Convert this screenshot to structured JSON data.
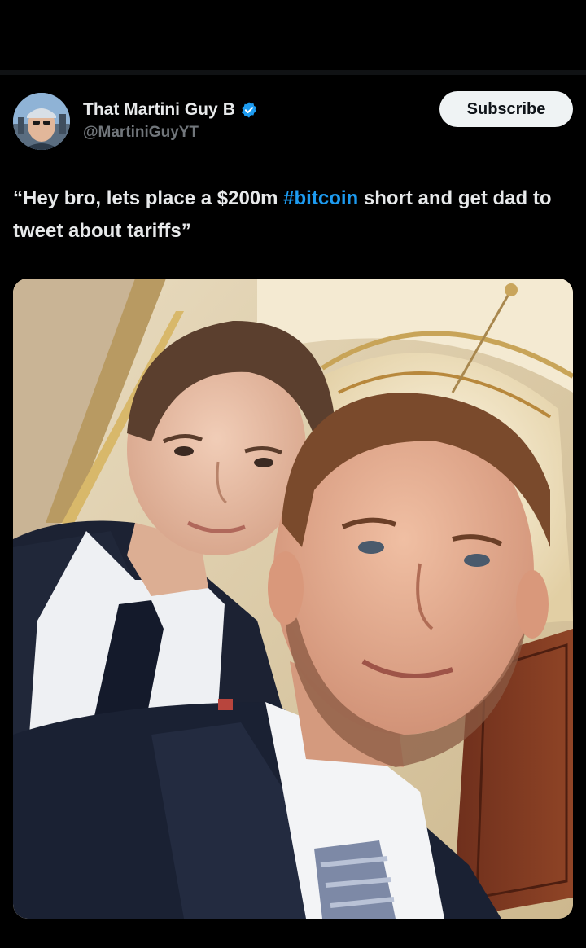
{
  "post": {
    "display_name": "That Martini Guy",
    "name_suffix": "B",
    "handle": "@MartiniGuyYT",
    "subscribe_label": "Subscribe",
    "text_open_quote": "“",
    "text_before": "Hey bro, lets place a $200m ",
    "hashtag": "#bitcoin",
    "text_after": " short and get dad to tweet about tariffs",
    "text_close_quote": "”",
    "verified_icon": "verified-badge-icon",
    "media_description_icon": "photo"
  },
  "colors": {
    "background": "#000000",
    "text": "#e7e9ea",
    "secondary_text": "#71767b",
    "hashtag": "#1d9bf0",
    "verified": "#1d9bf0",
    "subscribe_bg": "#eff3f4"
  }
}
